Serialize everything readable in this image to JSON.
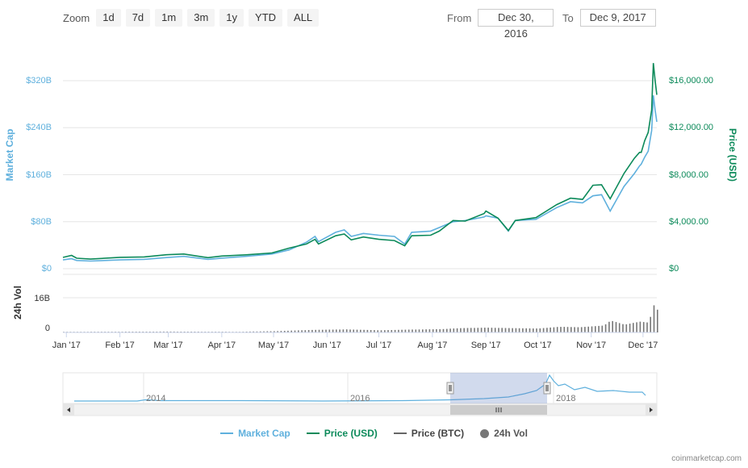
{
  "zoom": {
    "label": "Zoom",
    "buttons": [
      "1d",
      "7d",
      "1m",
      "3m",
      "1y",
      "YTD",
      "ALL"
    ]
  },
  "range": {
    "from_label": "From",
    "from_value": "Dec 30, 2016",
    "to_label": "To",
    "to_value": "Dec 9, 2017"
  },
  "legend": {
    "market_cap": "Market Cap",
    "price_usd": "Price (USD)",
    "price_btc": "Price (BTC)",
    "vol": "24h Vol"
  },
  "credit": "coinmarketcap.com",
  "colors": {
    "market_cap": "#5fb0dd",
    "price_usd": "#0c8a5a",
    "price_btc": "#666666",
    "volume": "#777777"
  },
  "chart_data": {
    "type": "line",
    "x_labels": [
      "Jan '17",
      "Feb '17",
      "Mar '17",
      "Apr '17",
      "May '17",
      "Jun '17",
      "Jul '17",
      "Aug '17",
      "Sep '17",
      "Oct '17",
      "Nov '17",
      "Dec '17"
    ],
    "x_start": "2016-12-30",
    "x_end": "2017-12-09",
    "left_axis": {
      "label": "Market Cap",
      "ticks": [
        "$0",
        "$80B",
        "$160B",
        "$240B",
        "$320B"
      ],
      "range": [
        0,
        320
      ]
    },
    "right_axis": {
      "label": "Price (USD)",
      "ticks": [
        "$0",
        "$4,000.00",
        "$8,000.00",
        "$12,000.00",
        "$16,000.00"
      ],
      "range": [
        0,
        16000
      ]
    },
    "volume_axis": {
      "label": "24h Vol",
      "ticks": [
        "0",
        "16B"
      ],
      "range": [
        0,
        16
      ]
    },
    "series": [
      {
        "name": "Price (USD)",
        "points": [
          [
            "2016-12-30",
            960
          ],
          [
            "2017-01-04",
            1130
          ],
          [
            "2017-01-07",
            890
          ],
          [
            "2017-01-15",
            820
          ],
          [
            "2017-02-01",
            970
          ],
          [
            "2017-02-15",
            1000
          ],
          [
            "2017-02-28",
            1190
          ],
          [
            "2017-03-10",
            1250
          ],
          [
            "2017-03-24",
            940
          ],
          [
            "2017-04-01",
            1080
          ],
          [
            "2017-04-15",
            1180
          ],
          [
            "2017-04-30",
            1340
          ],
          [
            "2017-05-10",
            1750
          ],
          [
            "2017-05-20",
            2100
          ],
          [
            "2017-05-25",
            2500
          ],
          [
            "2017-05-27",
            2100
          ],
          [
            "2017-06-06",
            2800
          ],
          [
            "2017-06-11",
            2950
          ],
          [
            "2017-06-15",
            2450
          ],
          [
            "2017-06-22",
            2700
          ],
          [
            "2017-07-01",
            2500
          ],
          [
            "2017-07-10",
            2400
          ],
          [
            "2017-07-16",
            1950
          ],
          [
            "2017-07-20",
            2800
          ],
          [
            "2017-07-31",
            2850
          ],
          [
            "2017-08-05",
            3200
          ],
          [
            "2017-08-13",
            4100
          ],
          [
            "2017-08-20",
            4050
          ],
          [
            "2017-08-31",
            4700
          ],
          [
            "2017-09-01",
            4900
          ],
          [
            "2017-09-08",
            4300
          ],
          [
            "2017-09-14",
            3250
          ],
          [
            "2017-09-18",
            4100
          ],
          [
            "2017-09-30",
            4350
          ],
          [
            "2017-10-12",
            5450
          ],
          [
            "2017-10-20",
            6000
          ],
          [
            "2017-10-27",
            5900
          ],
          [
            "2017-11-02",
            7100
          ],
          [
            "2017-11-07",
            7150
          ],
          [
            "2017-11-12",
            5950
          ],
          [
            "2017-11-20",
            8100
          ],
          [
            "2017-11-26",
            9400
          ],
          [
            "2017-11-29",
            9900
          ],
          [
            "2017-11-30",
            9900
          ],
          [
            "2017-12-02",
            10900
          ],
          [
            "2017-12-04",
            11600
          ],
          [
            "2017-12-06",
            13500
          ],
          [
            "2017-12-07",
            17500
          ],
          [
            "2017-12-08",
            16000
          ],
          [
            "2017-12-09",
            14800
          ]
        ]
      },
      {
        "name": "Market Cap",
        "unit": "B",
        "points": [
          [
            "2016-12-30",
            15
          ],
          [
            "2017-01-04",
            17
          ],
          [
            "2017-01-07",
            14
          ],
          [
            "2017-01-15",
            13
          ],
          [
            "2017-02-01",
            15
          ],
          [
            "2017-02-15",
            16
          ],
          [
            "2017-02-28",
            19
          ],
          [
            "2017-03-10",
            21
          ],
          [
            "2017-03-24",
            16
          ],
          [
            "2017-04-01",
            18
          ],
          [
            "2017-04-15",
            21
          ],
          [
            "2017-04-30",
            25
          ],
          [
            "2017-05-10",
            32
          ],
          [
            "2017-05-20",
            45
          ],
          [
            "2017-05-25",
            55
          ],
          [
            "2017-05-27",
            46
          ],
          [
            "2017-06-06",
            62
          ],
          [
            "2017-06-11",
            66
          ],
          [
            "2017-06-15",
            55
          ],
          [
            "2017-06-22",
            60
          ],
          [
            "2017-07-01",
            57
          ],
          [
            "2017-07-10",
            55
          ],
          [
            "2017-07-16",
            42
          ],
          [
            "2017-07-20",
            62
          ],
          [
            "2017-07-31",
            64
          ],
          [
            "2017-08-05",
            70
          ],
          [
            "2017-08-13",
            80
          ],
          [
            "2017-08-20",
            82
          ],
          [
            "2017-08-31",
            88
          ],
          [
            "2017-09-01",
            90
          ],
          [
            "2017-09-08",
            86
          ],
          [
            "2017-09-14",
            64
          ],
          [
            "2017-09-18",
            82
          ],
          [
            "2017-09-30",
            84
          ],
          [
            "2017-10-12",
            104
          ],
          [
            "2017-10-20",
            114
          ],
          [
            "2017-10-27",
            112
          ],
          [
            "2017-11-02",
            124
          ],
          [
            "2017-11-07",
            126
          ],
          [
            "2017-11-12",
            98
          ],
          [
            "2017-11-20",
            140
          ],
          [
            "2017-11-26",
            162
          ],
          [
            "2017-11-29",
            175
          ],
          [
            "2017-11-30",
            178
          ],
          [
            "2017-12-02",
            190
          ],
          [
            "2017-12-04",
            200
          ],
          [
            "2017-12-06",
            235
          ],
          [
            "2017-12-07",
            295
          ],
          [
            "2017-12-08",
            270
          ],
          [
            "2017-12-09",
            250
          ]
        ]
      }
    ],
    "volume": {
      "points": [
        [
          "2017-01-05",
          0.3
        ],
        [
          "2017-03-01",
          0.4
        ],
        [
          "2017-04-10",
          0.3
        ],
        [
          "2017-05-01",
          0.6
        ],
        [
          "2017-05-25",
          1.2
        ],
        [
          "2017-06-12",
          1.4
        ],
        [
          "2017-07-01",
          1.0
        ],
        [
          "2017-07-17",
          1.3
        ],
        [
          "2017-08-05",
          1.5
        ],
        [
          "2017-08-18",
          2.0
        ],
        [
          "2017-09-01",
          2.2
        ],
        [
          "2017-09-15",
          2.0
        ],
        [
          "2017-10-01",
          1.8
        ],
        [
          "2017-10-13",
          2.6
        ],
        [
          "2017-10-25",
          2.4
        ],
        [
          "2017-11-08",
          3.2
        ],
        [
          "2017-11-12",
          5.5
        ],
        [
          "2017-11-20",
          3.6
        ],
        [
          "2017-11-29",
          5.0
        ],
        [
          "2017-12-04",
          4.5
        ],
        [
          "2017-12-07",
          12.5
        ],
        [
          "2017-12-08",
          14.5
        ],
        [
          "2017-12-09",
          10.5
        ]
      ]
    },
    "navigator": {
      "labels": [
        "2014",
        "2016",
        "2018"
      ]
    }
  }
}
